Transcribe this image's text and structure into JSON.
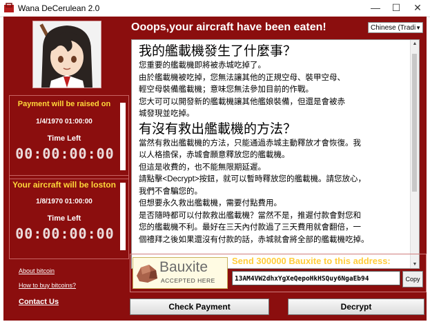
{
  "window": {
    "title": "Wana DeCerulean 2.0",
    "controls": {
      "minimize": "—",
      "maximize": "☐",
      "close": "✕"
    }
  },
  "colors": {
    "background": "#8b0e0e",
    "heading_accent": "#ffd83a",
    "send_accent": "#ffcc3a"
  },
  "header": {
    "heading": "Ooops,your aircraft have been eaten!",
    "language": "Chinese (Tradi"
  },
  "message": {
    "lines": [
      "我的艦載機發生了什麼事？",
      "您重要的艦載機即將被赤城吃掉了。",
      "由於艦載機被吃掉，您無法讓其他的正規空母、裝甲空母、",
      "輕空母裝備艦載機；意味您無法參加目前的作戰。",
      "您大可可以開發新的艦載機讓其他艦娘裝備，但還是會被赤",
      "城發現並吃掉。",
      "有沒有救出艦載機的方法？",
      "當然有救出艦載機的方法，只能通過赤城主動釋放才會恢復。我",
      "以人格擔保，赤城會願意釋放您的艦載機。",
      "但這是收費的，也不能無限期延遲。",
      "請點擊<Decrypt>按鈕，就可以暫時釋放您的艦載機。請您放心，",
      "我們不會騙您的。",
      "但想要永久救出艦載機，需要付點費用。",
      "是否隨時都可以付款救出艦載機？當然不是，推遲付款會對您和",
      "您的艦載機不利。最好在三天內付款過了三天費用就會翻倍，一",
      "個禮拜之後如果還沒有付款的話，赤城就會將全部的艦載機吃掉。"
    ]
  },
  "timers": [
    {
      "title": "Payment will be raised on",
      "date": "1/4/1970 01:00:00",
      "time_left_label": "Time Left",
      "countdown": "00:00:00:00"
    },
    {
      "title": "Your aircraft will be loston",
      "date": "1/8/1970 01:00:00",
      "time_left_label": "Time Left",
      "countdown": "00:00:00:00"
    }
  ],
  "links": {
    "about": "About bitcoin",
    "howto": "How to buy bitcoins?",
    "contact": "Contact Us"
  },
  "payment": {
    "logo_text": "Bauxite",
    "logo_sub": "ACCEPTED HERE",
    "send_label": "Send 300000 Bauxite to this address:",
    "address": "13AM4VW2dhxYgXeQepoHkHSQuy6NgaEb94",
    "copy_label": "Copy"
  },
  "buttons": {
    "check": "Check Payment",
    "decrypt": "Decrypt"
  }
}
